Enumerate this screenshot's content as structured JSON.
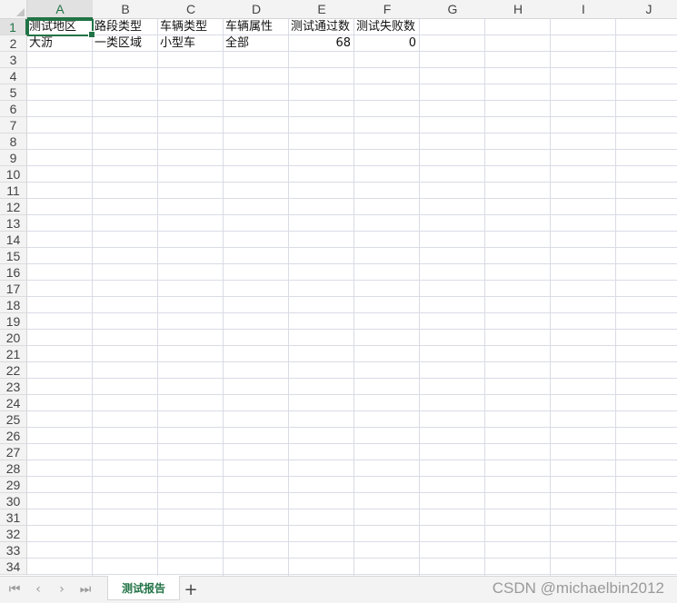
{
  "columns": [
    "A",
    "B",
    "C",
    "D",
    "E",
    "F",
    "G",
    "H",
    "I",
    "J"
  ],
  "active_column": "A",
  "active_row": 1,
  "row_count": 34,
  "cells": [
    {
      "col": "A",
      "row": 1,
      "value": "测试地区"
    },
    {
      "col": "B",
      "row": 1,
      "value": "路段类型"
    },
    {
      "col": "C",
      "row": 1,
      "value": "车辆类型"
    },
    {
      "col": "D",
      "row": 1,
      "value": "车辆属性"
    },
    {
      "col": "E",
      "row": 1,
      "value": "测试通过数"
    },
    {
      "col": "F",
      "row": 1,
      "value": "测试失败数"
    },
    {
      "col": "A",
      "row": 2,
      "value": "大沥"
    },
    {
      "col": "B",
      "row": 2,
      "value": "一类区域"
    },
    {
      "col": "C",
      "row": 2,
      "value": "小型车"
    },
    {
      "col": "D",
      "row": 2,
      "value": "全部"
    },
    {
      "col": "E",
      "row": 2,
      "value": "68",
      "numeric": true
    },
    {
      "col": "F",
      "row": 2,
      "value": "0",
      "numeric": true
    }
  ],
  "sheet_nav": {
    "first_icon": "first-sheet-icon",
    "prev_icon": "prev-sheet-icon",
    "next_icon": "next-sheet-icon",
    "last_icon": "last-sheet-icon"
  },
  "sheet_tabs": [
    {
      "label": "测试报告",
      "active": true
    }
  ],
  "add_sheet_label": "+",
  "watermark": "CSDN @michaelbin2012",
  "colors": {
    "accent": "#217346",
    "gridline": "#d9dbe6",
    "header_bg": "#f3f3f3"
  }
}
